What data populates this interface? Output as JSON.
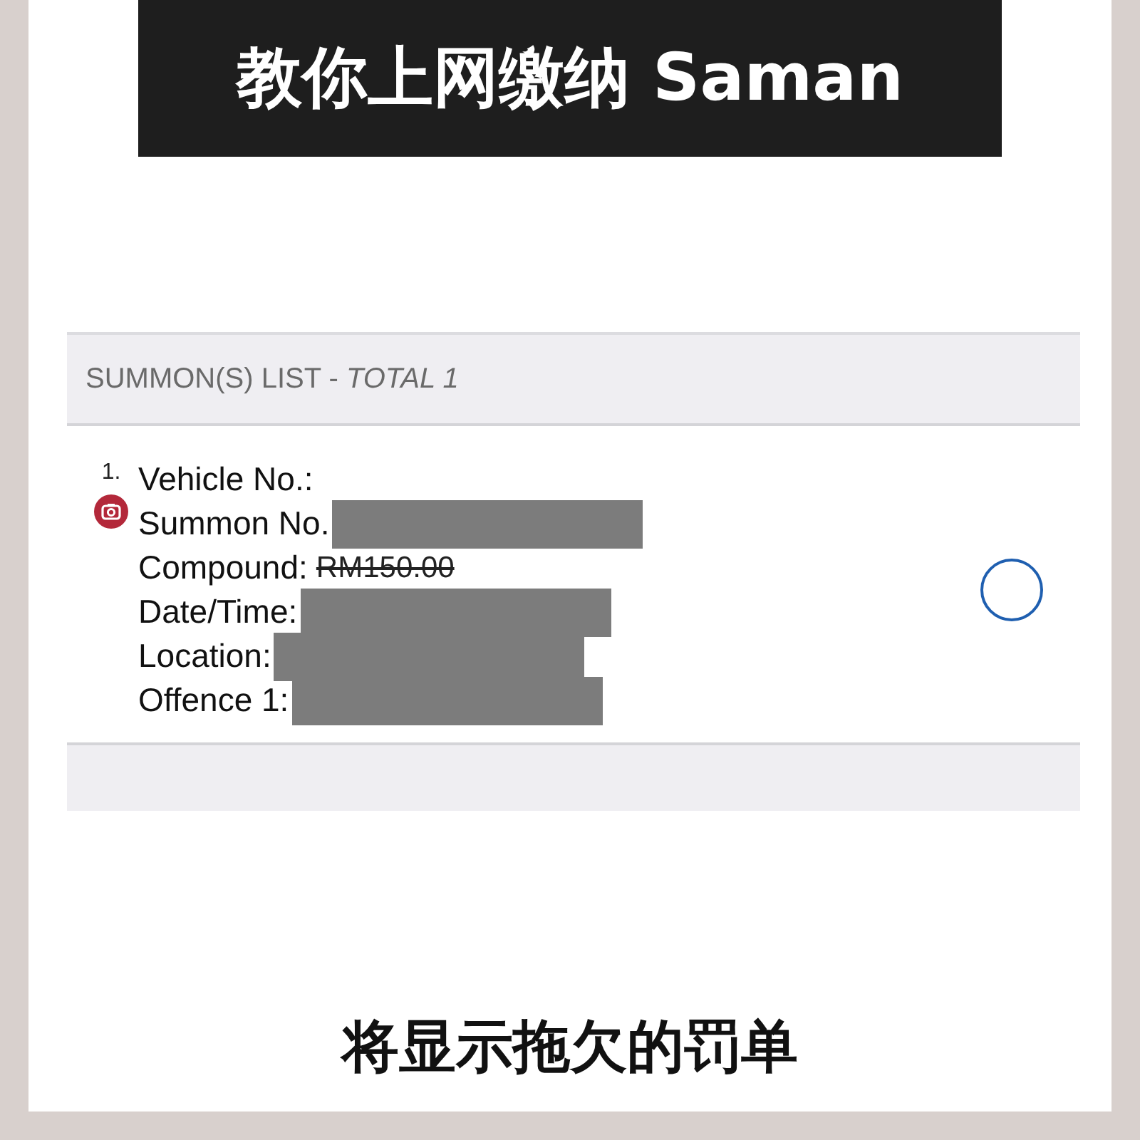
{
  "title": "教你上网缴纳 Saman",
  "list": {
    "header": "SUMMON(S) LIST - *TOTAL 1*",
    "items": [
      {
        "number": "1.",
        "selected": false,
        "fields": [
          {
            "label": "Vehicle No.:",
            "redacted": false
          },
          {
            "label": "Summon No.",
            "redacted": true
          },
          {
            "label": "Compound:",
            "value": "RM150.00",
            "struck": true,
            "redacted": false
          },
          {
            "label": "Date/Time:",
            "redacted": true
          },
          {
            "label": "Location:",
            "redacted": true
          },
          {
            "label": "Offence 1:",
            "redacted": true
          }
        ]
      }
    ]
  },
  "caption": "将显示拖欠的罚单"
}
